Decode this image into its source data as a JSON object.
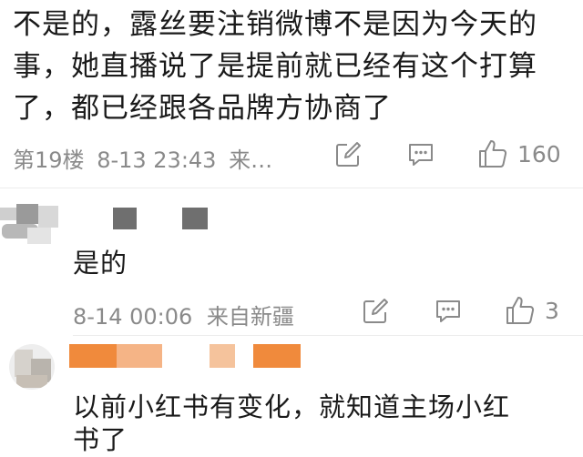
{
  "post": {
    "lines": [
      "不是的，露丝要注销微博不是因为今天的",
      "事，她直播说了是提前就已经有这个打算",
      "了，都已经跟各品牌方协商了"
    ],
    "floor": "第19楼",
    "time": "8-13 23:43",
    "source": "来…",
    "like_count": "160"
  },
  "reply1": {
    "text": "是的",
    "time": "8-14 00:06",
    "source": "来自新疆",
    "like_count": "3"
  },
  "reply2": {
    "text_line1": "以前小红书有变化，就知道主场小红",
    "text_line2": "书了"
  },
  "icons": {
    "share": "share-icon",
    "comment": "comment-icon",
    "like": "thumbs-up-icon"
  },
  "colors": {
    "meta": "#8a8a8a",
    "divider": "#ececec",
    "redacted_orange": "#f08a3c"
  }
}
